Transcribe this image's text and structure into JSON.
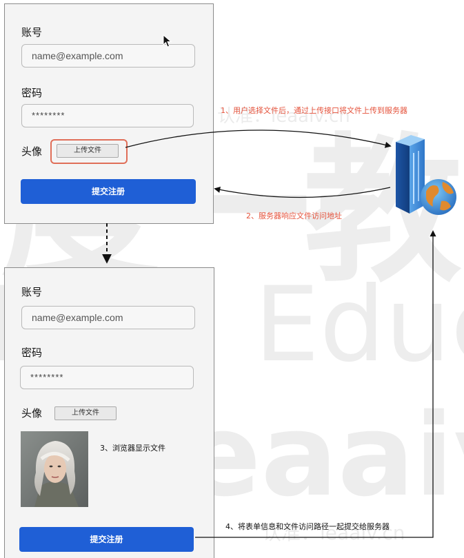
{
  "watermark": {
    "big": "度一教",
    "edu": "Duyi Educa",
    "site": "leaaiv.cr",
    "small1": "认准：leaaiv.cn",
    "small2": "认准：leaaiv.cn"
  },
  "form_top": {
    "account_label": "账号",
    "account_placeholder": "name@example.com",
    "password_label": "密码",
    "password_value": "********",
    "avatar_label": "头像",
    "upload_label": "上传文件",
    "submit_label": "提交注册"
  },
  "form_bottom": {
    "account_label": "账号",
    "account_placeholder": "name@example.com",
    "password_label": "密码",
    "password_value": "********",
    "avatar_label": "头像",
    "upload_label": "上传文件",
    "submit_label": "提交注册"
  },
  "steps": {
    "step1": "1、用户选择文件后，通过上传接口将文件上传到服务器",
    "step2": "2、服务器响应文件访问地址",
    "step3": "3、浏览器显示文件",
    "step4": "4、将表单信息和文件访问路径一起提交给服务器"
  },
  "colors": {
    "accent_blue": "#1f5fd6",
    "annotation_red": "#e5533c",
    "highlight_border": "#e06e58"
  },
  "icons": {
    "server": "server-globe-icon",
    "cursor": "mouse-cursor-icon",
    "avatar": "avatar-photo"
  }
}
